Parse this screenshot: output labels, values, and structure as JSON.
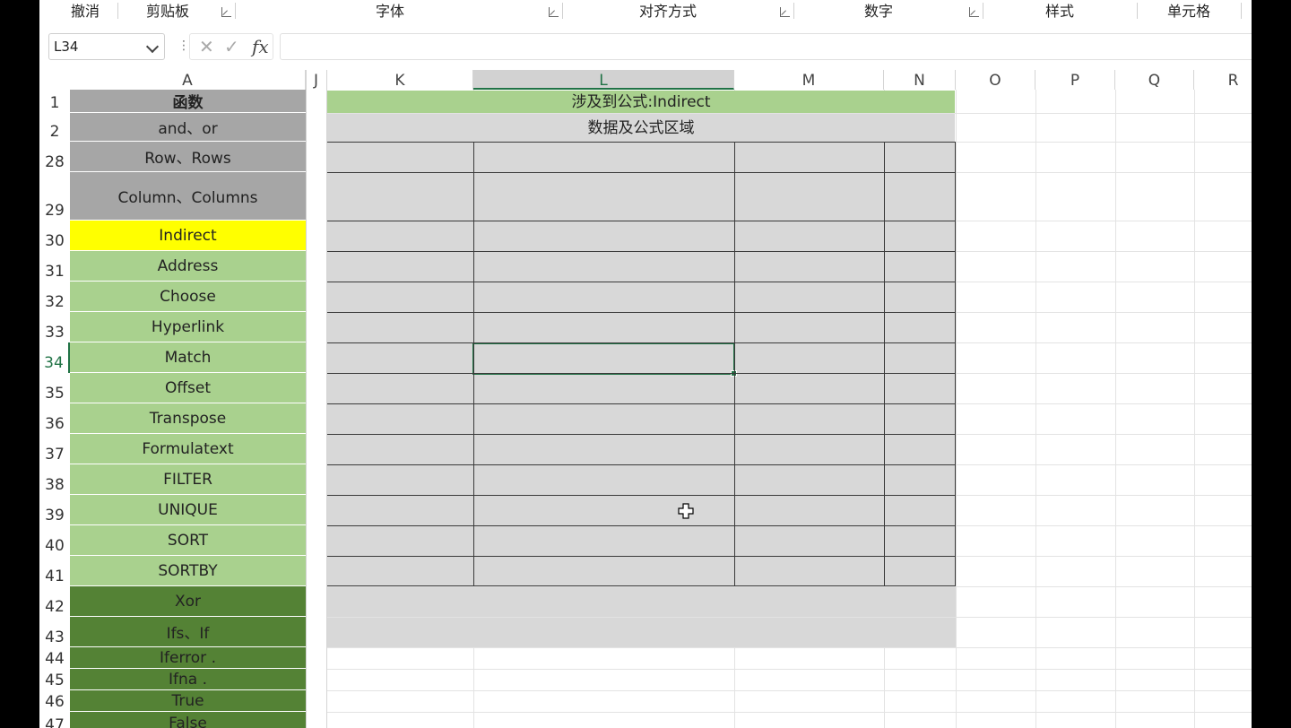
{
  "ribbon": {
    "groups": [
      {
        "label": "撤消"
      },
      {
        "label": "剪贴板"
      },
      {
        "label": "字体"
      },
      {
        "label": "对齐方式"
      },
      {
        "label": "数字"
      },
      {
        "label": "样式"
      },
      {
        "label": "单元格"
      }
    ]
  },
  "formula_bar": {
    "name_box": "L34",
    "formula": "",
    "fx_label": "fx"
  },
  "columns": [
    "A",
    "J",
    "K",
    "L",
    "M",
    "N",
    "O",
    "P",
    "Q",
    "R"
  ],
  "selected_column": "L",
  "selected_row": "34",
  "rows": [
    {
      "num": "1",
      "a": "函数",
      "style": "header"
    },
    {
      "num": "2",
      "a": "and、or",
      "style": "gray"
    },
    {
      "num": "28",
      "a": "Row、Rows",
      "style": "gray"
    },
    {
      "num": "29",
      "a": "Column、Columns",
      "style": "gray"
    },
    {
      "num": "30",
      "a": "Indirect",
      "style": "yellow"
    },
    {
      "num": "31",
      "a": "Address",
      "style": "lightgreen"
    },
    {
      "num": "32",
      "a": "Choose",
      "style": "lightgreen"
    },
    {
      "num": "33",
      "a": "Hyperlink",
      "style": "lightgreen"
    },
    {
      "num": "34",
      "a": "Match",
      "style": "lightgreen"
    },
    {
      "num": "35",
      "a": "Offset",
      "style": "lightgreen"
    },
    {
      "num": "36",
      "a": "Transpose",
      "style": "lightgreen"
    },
    {
      "num": "37",
      "a": "Formulatext",
      "style": "lightgreen"
    },
    {
      "num": "38",
      "a": "FILTER",
      "style": "lightgreen"
    },
    {
      "num": "39",
      "a": "UNIQUE",
      "style": "lightgreen"
    },
    {
      "num": "40",
      "a": "SORT",
      "style": "lightgreen"
    },
    {
      "num": "41",
      "a": "SORTBY",
      "style": "lightgreen"
    },
    {
      "num": "42",
      "a": "Xor",
      "style": "darkgreen"
    },
    {
      "num": "43",
      "a": "Ifs、If",
      "style": "darkgreen"
    },
    {
      "num": "44",
      "a": "Iferror .",
      "style": "darkgreen"
    },
    {
      "num": "45",
      "a": "Ifna .",
      "style": "darkgreen"
    },
    {
      "num": "46",
      "a": "True",
      "style": "darkgreen"
    },
    {
      "num": "47",
      "a": "False",
      "style": "darkgreen"
    }
  ],
  "merged": {
    "title": "涉及到公式:Indirect",
    "subtitle": "数据及公式区域"
  },
  "colors": {
    "gray": "#a6a6a6",
    "yellow": "#ffff00",
    "lightgreen": "#a9d18e",
    "darkgreen": "#548235",
    "header": "#a6a6a6",
    "accent": "#217346"
  }
}
